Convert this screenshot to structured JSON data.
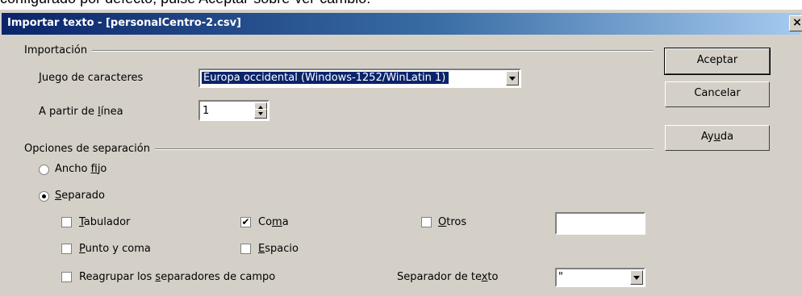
{
  "background_caption": "configurado por defecto, pulse Aceptar-sobre-ver-cambio.",
  "dialog": {
    "title": "Importar texto - [personalCentro-2.csv]",
    "close_glyph": "×"
  },
  "import_group": {
    "label": "Importación",
    "charset_label_u": "J",
    "charset_label_rest": "uego de caracteres",
    "charset_value": "Europa occidental (Windows-1252/WinLatin 1)",
    "from_line_label_pre": "A partir de ",
    "from_line_label_u": "l",
    "from_line_label_rest": "ínea",
    "from_line_value": "1"
  },
  "separator_group": {
    "label": "Opciones de separación",
    "fixed_width_pre": "Ancho ",
    "fixed_width_u": "f",
    "fixed_width_rest": "ijo",
    "separated_u": "S",
    "separated_rest": "eparado",
    "separated_selected": true,
    "tab_u": "T",
    "tab_rest": "abulador",
    "comma_pre": "Co",
    "comma_u": "m",
    "comma_rest": "a",
    "comma_checked": true,
    "other_u": "O",
    "other_rest": "tros",
    "other_value": "",
    "semicolon_u": "P",
    "semicolon_rest": "unto y coma",
    "space_u": "E",
    "space_rest": "spacio",
    "merge_pre": "Reagrupar los ",
    "merge_u": "s",
    "merge_rest": "eparadores de campo",
    "text_sep_pre": "Separador de te",
    "text_sep_u": "x",
    "text_sep_rest": "to",
    "text_sep_value": "\""
  },
  "buttons": {
    "ok": "Aceptar",
    "cancel": "Cancelar",
    "help_pre": "Ay",
    "help_u": "u",
    "help_rest": "da"
  },
  "check_glyph": "✔"
}
